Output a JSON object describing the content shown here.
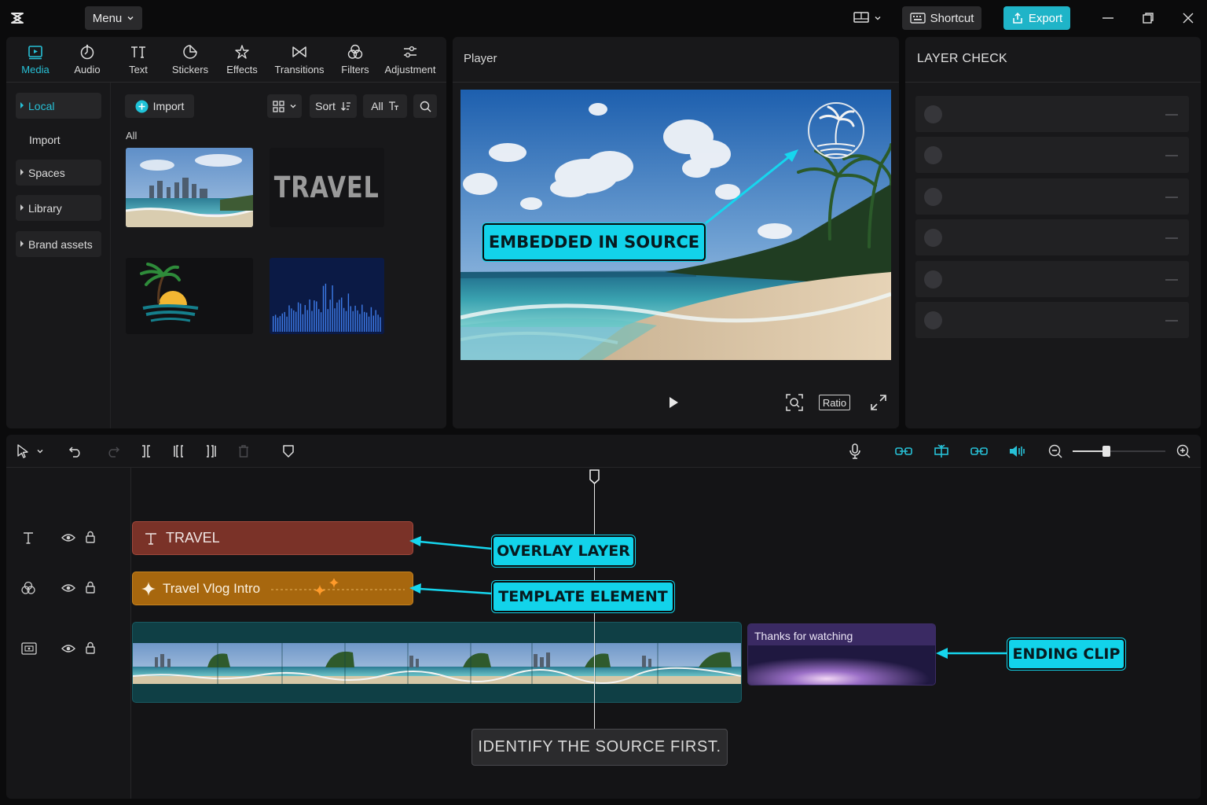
{
  "titlebar": {
    "menu_label": "Menu",
    "shortcut_label": "Shortcut",
    "export_label": "Export"
  },
  "media": {
    "tabs": [
      {
        "label": "Media",
        "icon": "media-icon",
        "active": true
      },
      {
        "label": "Audio",
        "icon": "audio-icon"
      },
      {
        "label": "Text",
        "icon": "text-icon"
      },
      {
        "label": "Stickers",
        "icon": "stickers-icon"
      },
      {
        "label": "Effects",
        "icon": "effects-icon"
      },
      {
        "label": "Transitions",
        "icon": "transitions-icon"
      },
      {
        "label": "Filters",
        "icon": "filters-icon"
      },
      {
        "label": "Adjustment",
        "icon": "adjustment-icon"
      }
    ],
    "nav": [
      {
        "label": "Local",
        "active": true
      },
      {
        "label": "Import"
      },
      {
        "label": "Spaces"
      },
      {
        "label": "Library"
      },
      {
        "label": "Brand assets"
      }
    ],
    "import_label": "Import",
    "sort_label": "Sort",
    "filter_label": "All",
    "section_label": "All",
    "thumb_travel_text": "TRAVEL"
  },
  "player": {
    "title": "Player",
    "ratio_label": "Ratio",
    "callout": "EMBEDDED IN SOURCE"
  },
  "layer_check": {
    "title": "LAYER CHECK",
    "rows": 6
  },
  "timeline": {
    "text_clip_label": "TRAVEL",
    "template_clip_label": "Travel Vlog Intro",
    "end_clip_label": "Thanks for watching",
    "zoom_level": 0.07,
    "callouts": {
      "overlay": "OVERLAY LAYER",
      "template": "TEMPLATE ELEMENT",
      "ending": "ENDING CLIP"
    },
    "hint": "IDENTIFY THE SOURCE FIRST."
  },
  "colors": {
    "accent": "#27c0d6",
    "callout": "#12d3ea",
    "text_clip": "#7a3228",
    "template_clip": "#a7670e",
    "video_clip": "#0f3f45",
    "end_clip": "#2a1d48"
  }
}
